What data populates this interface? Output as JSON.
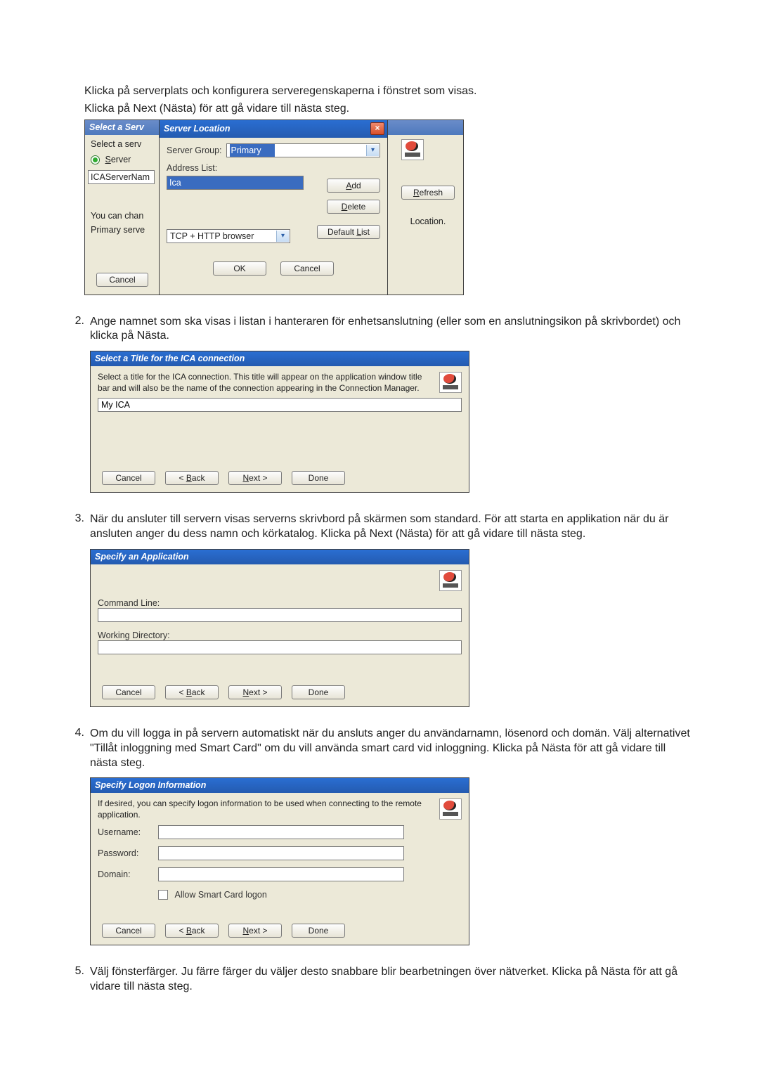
{
  "intro1": "Klicka på serverplats och konfigurera serveregenskaperna i fönstret som visas.",
  "intro2": "Klicka på Next (Nästa) för att gå vidare till nästa steg.",
  "step2": {
    "num": "2.",
    "text": "Ange namnet som ska visas i listan i hanteraren för enhetsanslutning (eller som en anslutningsikon på skrivbordet) och klicka på Nästa."
  },
  "step3": {
    "num": "3.",
    "text": "När du ansluter till servern visas serverns skrivbord på skärmen som standard. För att starta en applikation när du är ansluten anger du dess namn och körkatalog. Klicka på Next (Nästa) för att gå vidare till nästa steg."
  },
  "step4": {
    "num": "4.",
    "text": "Om du vill logga in på servern automatiskt när du ansluts anger du användarnamn, lösenord och domän. Välj alternativet \"Tillåt inloggning med Smart Card\" om du vill använda smart card vid inloggning. Klicka på Nästa för att gå vidare till nästa steg."
  },
  "step5": {
    "num": "5.",
    "text": "Välj fönsterfärger. Ju färre färger du väljer desto snabbare blir bearbetningen över nätverket. Klicka på Nästa för att gå vidare till nästa steg."
  },
  "dlg1_back": {
    "title": "Select a Serv",
    "select_serve": "Select a serv",
    "server_radio": "Server",
    "ica_name": "ICAServerNam",
    "you_can_chan": "You can chan",
    "primary_serve": "Primary serve",
    "cancel": "Cancel",
    "refresh": "Refresh",
    "location": "Location."
  },
  "dlg1_front": {
    "title": "Server Location",
    "server_group": "Server Group:",
    "primary": "Primary",
    "address_list": "Address List:",
    "ica": "Ica",
    "add": "Add",
    "delete": "Delete",
    "default_list": "Default List",
    "protocol": "TCP + HTTP browser",
    "ok": "OK",
    "cancel": "Cancel"
  },
  "dlg2": {
    "title": "Select a Title for the ICA connection",
    "desc": "Select a title for the ICA connection. This title will appear on the application window title bar and will also be the name of the connection appearing in the Connection Manager.",
    "value": "My ICA",
    "cancel": "Cancel",
    "back": "< Back",
    "next": "Next >",
    "done": "Done"
  },
  "dlg3": {
    "title": "Specify an Application",
    "cmd": "Command Line:",
    "wd": "Working Directory:",
    "cancel": "Cancel",
    "back": "< Back",
    "next": "Next >",
    "done": "Done"
  },
  "dlg4": {
    "title": "Specify Logon Information",
    "desc": "If desired, you can specify logon information to be used when connecting to the remote application.",
    "user": "Username:",
    "pass": "Password:",
    "domain": "Domain:",
    "smart": "Allow Smart Card logon",
    "cancel": "Cancel",
    "back": "< Back",
    "next": "Next >",
    "done": "Done"
  }
}
